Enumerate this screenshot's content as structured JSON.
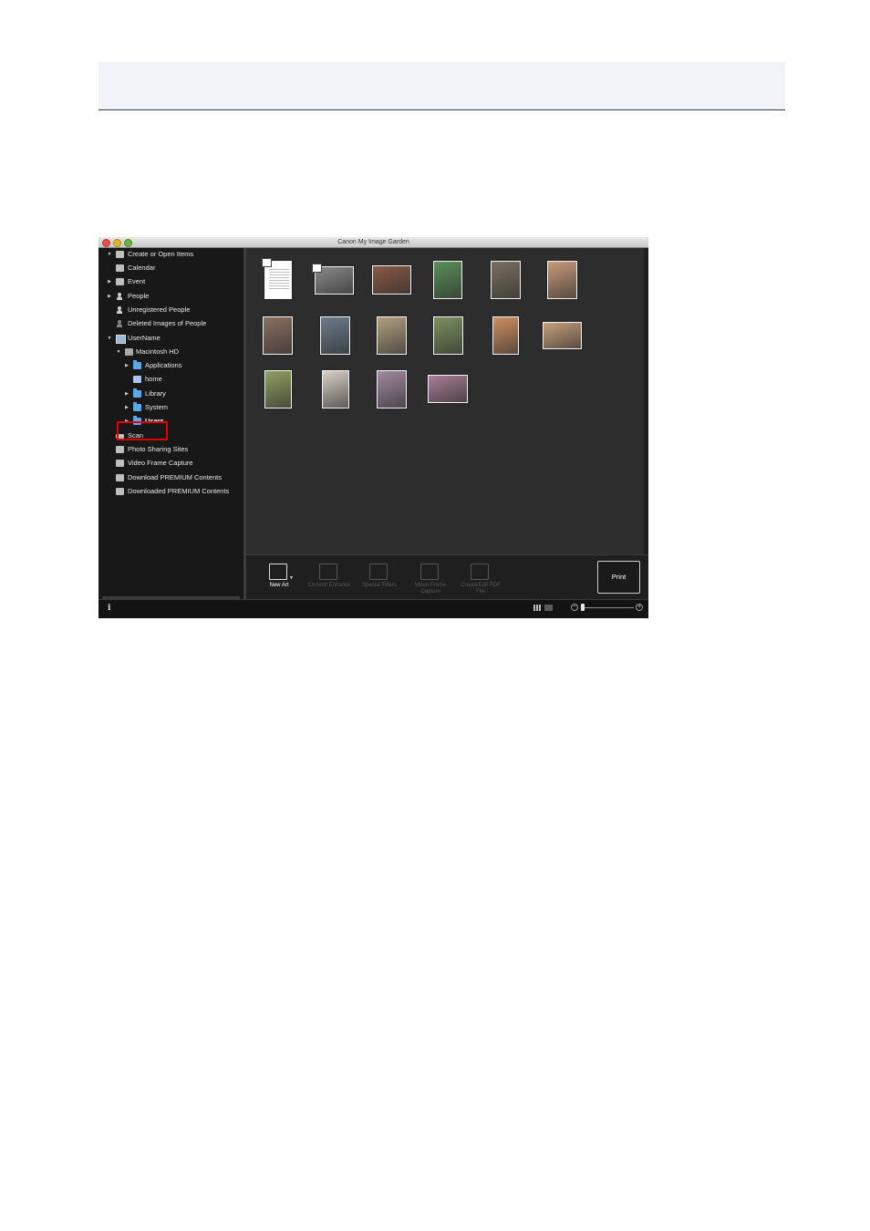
{
  "window": {
    "title": "Canon My Image Garden"
  },
  "sidebar": {
    "items": [
      {
        "label": "Create or Open Items"
      },
      {
        "label": "Calendar"
      },
      {
        "label": "Event"
      },
      {
        "label": "People"
      },
      {
        "label": "Unregistered People"
      },
      {
        "label": "Deleted Images of People"
      },
      {
        "label": "UserName"
      },
      {
        "label": "Macintosh HD"
      },
      {
        "label": "Applications"
      },
      {
        "label": "home"
      },
      {
        "label": "Library"
      },
      {
        "label": "System"
      },
      {
        "label": "Users"
      },
      {
        "label": "Scan"
      },
      {
        "label": "Photo Sharing Sites"
      },
      {
        "label": "Video Frame Capture"
      },
      {
        "label": "Download PREMIUM Contents"
      },
      {
        "label": "Downloaded PREMIUM Contents"
      }
    ],
    "selected": "Users",
    "highlight_color": "#e00000"
  },
  "toolbar": {
    "new_art": "New Art",
    "correct_enhance": "Correct/ Enhance",
    "special_filters": "Special Filters",
    "video_frame_capture": "Video Frame Capture",
    "create_edit_pdf": "Create/Edit PDF File",
    "print": "Print"
  },
  "statusbar": {
    "info_icon": "i"
  },
  "thumbnails": [
    {
      "kind": "document",
      "badge": "pdf-icon",
      "color": "#ffffff"
    },
    {
      "kind": "video",
      "badge": "video-icon",
      "color": "#8a8a8a"
    },
    {
      "kind": "photo",
      "color": "#8a5a45"
    },
    {
      "kind": "photo",
      "color": "#5a8f5a"
    },
    {
      "kind": "photo",
      "color": "#7a7060"
    },
    {
      "kind": "photo",
      "color": "#c99a7a"
    },
    {
      "kind": "photo",
      "color": "#8a7060"
    },
    {
      "kind": "photo",
      "color": "#6b7c8c"
    },
    {
      "kind": "photo",
      "color": "#b0a080"
    },
    {
      "kind": "photo",
      "color": "#7c9060"
    },
    {
      "kind": "photo",
      "color": "#d09060"
    },
    {
      "kind": "photo",
      "color": "#c7a07a"
    },
    {
      "kind": "photo",
      "color": "#8fa060"
    },
    {
      "kind": "photo",
      "color": "#d8d0c8"
    },
    {
      "kind": "photo",
      "color": "#a08aa0"
    },
    {
      "kind": "photo",
      "color": "#a77e96"
    }
  ]
}
